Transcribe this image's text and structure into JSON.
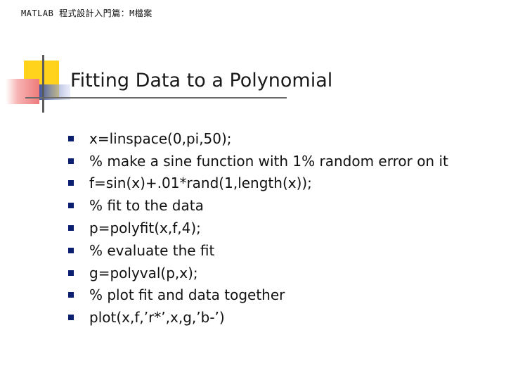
{
  "header": {
    "text": "MATLAB 程式設計入門篇：M檔案"
  },
  "slide": {
    "title": "Fitting Data to a Polynomial",
    "bullets": [
      "x=linspace(0,pi,50);",
      "% make a sine function with 1% random error on it",
      "f=sin(x)+.01*rand(1,length(x));",
      "% fit to the data",
      "p=polyfit(x,f,4);",
      "% evaluate the fit",
      "g=polyval(p,x);",
      "% plot fit and data together",
      "plot(x,f,’r*’,x,g,’b-’)"
    ]
  },
  "colors": {
    "accent_yellow": "#ffd21c",
    "accent_red": "#f08484",
    "accent_blue": "#4f63a8",
    "bullet": "#0a1f6e",
    "rule": "#6b6b6b"
  },
  "icons": {
    "bullet": "square-bullet-icon"
  }
}
